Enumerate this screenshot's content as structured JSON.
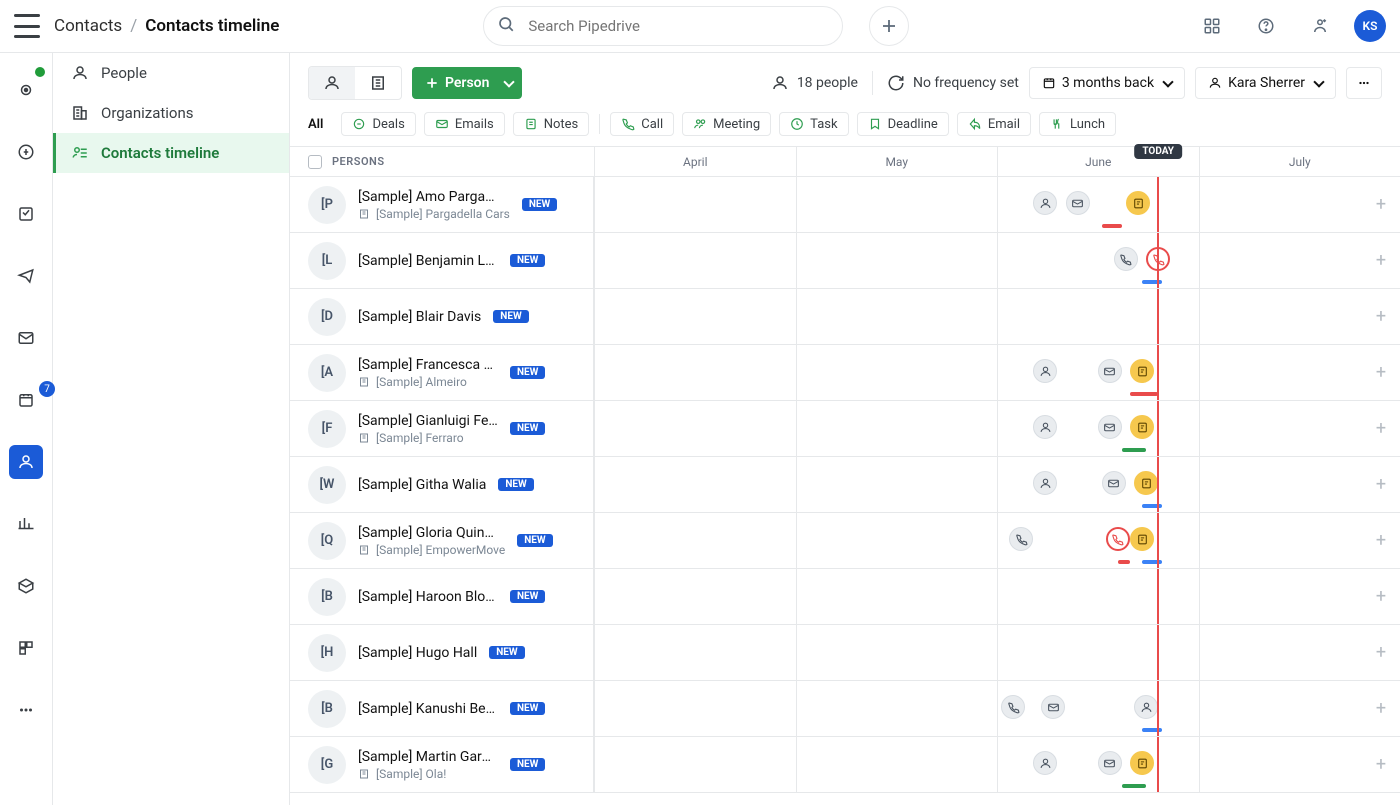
{
  "topbar": {
    "breadcrumb_root": "Contacts",
    "breadcrumb_leaf": "Contacts timeline",
    "search_placeholder": "Search Pipedrive",
    "avatar_initials": "KS"
  },
  "colors": {
    "primary_green": "#2e9d50",
    "status_red": "#e94b4b",
    "accent_blue": "#1b5bd7",
    "status_yellow": "#f6c84e"
  },
  "subnav": {
    "items": [
      {
        "label": "People",
        "active": false
      },
      {
        "label": "Organizations",
        "active": false
      },
      {
        "label": "Contacts timeline",
        "active": true
      }
    ]
  },
  "rail_badge": "7",
  "toolbar": {
    "person_btn": "Person",
    "people_count": "18 people",
    "frequency": "No frequency set",
    "range": "3 months back",
    "owner": "Kara Sherrer"
  },
  "filters": {
    "all": "All",
    "items": [
      {
        "label": "Deals"
      },
      {
        "label": "Emails"
      },
      {
        "label": "Notes"
      },
      {
        "label": "Call"
      },
      {
        "label": "Meeting"
      },
      {
        "label": "Task"
      },
      {
        "label": "Deadline"
      },
      {
        "label": "Email"
      },
      {
        "label": "Lunch"
      }
    ]
  },
  "timeline": {
    "persons_label": "PERSONS",
    "months": [
      "April",
      "May",
      "June",
      "July"
    ],
    "today_label": "TODAY",
    "today_percent": 70
  },
  "rows": [
    {
      "initials": "[P",
      "name": "[Sample] Amo Pargadella",
      "sub": "[Sample] Pargadella Cars",
      "new": true,
      "activities": [
        {
          "x": 56,
          "kind": "person"
        },
        {
          "x": 60,
          "kind": "mail"
        },
        {
          "x": 67.5,
          "kind": "note"
        }
      ],
      "bars": [
        {
          "x": 63,
          "w": 2.5,
          "color": "#e94b4b"
        }
      ]
    },
    {
      "initials": "[L",
      "name": "[Sample] Benjamin Lecomte",
      "sub": "",
      "new": true,
      "activities": [
        {
          "x": 66,
          "kind": "call"
        },
        {
          "x": 70,
          "kind": "call-red"
        }
      ],
      "bars": [
        {
          "x": 68,
          "w": 2.5,
          "color": "#3b82f6"
        }
      ]
    },
    {
      "initials": "[D",
      "name": "[Sample] Blair Davis",
      "sub": "",
      "new": true,
      "activities": [],
      "bars": []
    },
    {
      "initials": "[A",
      "name": "[Sample] Francesca Almeiro",
      "sub": "[Sample] Almeiro",
      "new": true,
      "activities": [
        {
          "x": 56,
          "kind": "person"
        },
        {
          "x": 64,
          "kind": "mail"
        },
        {
          "x": 68,
          "kind": "note"
        }
      ],
      "bars": [
        {
          "x": 66.5,
          "w": 3.5,
          "color": "#e94b4b"
        }
      ]
    },
    {
      "initials": "[F",
      "name": "[Sample] Gianluigi Ferraro",
      "sub": "[Sample] Ferraro",
      "new": true,
      "activities": [
        {
          "x": 56,
          "kind": "person"
        },
        {
          "x": 64,
          "kind": "mail"
        },
        {
          "x": 68,
          "kind": "note"
        }
      ],
      "bars": [
        {
          "x": 65.5,
          "w": 3,
          "color": "#2e9d50"
        }
      ]
    },
    {
      "initials": "[W",
      "name": "[Sample] Githa Walia",
      "sub": "",
      "new": true,
      "activities": [
        {
          "x": 56,
          "kind": "person"
        },
        {
          "x": 64.5,
          "kind": "mail"
        },
        {
          "x": 68.5,
          "kind": "note"
        }
      ],
      "bars": [
        {
          "x": 68,
          "w": 2.5,
          "color": "#3b82f6"
        }
      ]
    },
    {
      "initials": "[Q",
      "name": "[Sample] Gloria Quintero",
      "sub": "[Sample] EmpowerMove",
      "new": true,
      "activities": [
        {
          "x": 53,
          "kind": "call-grey"
        },
        {
          "x": 65,
          "kind": "call-red"
        },
        {
          "x": 68,
          "kind": "note"
        }
      ],
      "bars": [
        {
          "x": 65,
          "w": 1.5,
          "color": "#e94b4b"
        },
        {
          "x": 68,
          "w": 2.5,
          "color": "#3b82f6"
        }
      ]
    },
    {
      "initials": "[B",
      "name": "[Sample] Haroon Bloom",
      "sub": "",
      "new": true,
      "activities": [],
      "bars": []
    },
    {
      "initials": "[H",
      "name": "[Sample] Hugo Hall",
      "sub": "",
      "new": true,
      "activities": [],
      "bars": []
    },
    {
      "initials": "[B",
      "name": "[Sample] Kanushi Bennett",
      "sub": "",
      "new": true,
      "activities": [
        {
          "x": 52,
          "kind": "call-grey"
        },
        {
          "x": 57,
          "kind": "mail-grey"
        },
        {
          "x": 68.5,
          "kind": "person-grey"
        }
      ],
      "bars": [
        {
          "x": 68,
          "w": 2.5,
          "color": "#3b82f6"
        }
      ]
    },
    {
      "initials": "[G",
      "name": "[Sample] Martin Garcia",
      "sub": "[Sample] Ola!",
      "new": true,
      "activities": [
        {
          "x": 56,
          "kind": "person"
        },
        {
          "x": 64,
          "kind": "mail"
        },
        {
          "x": 68,
          "kind": "note"
        }
      ],
      "bars": [
        {
          "x": 65.5,
          "w": 3,
          "color": "#2e9d50"
        }
      ]
    }
  ]
}
